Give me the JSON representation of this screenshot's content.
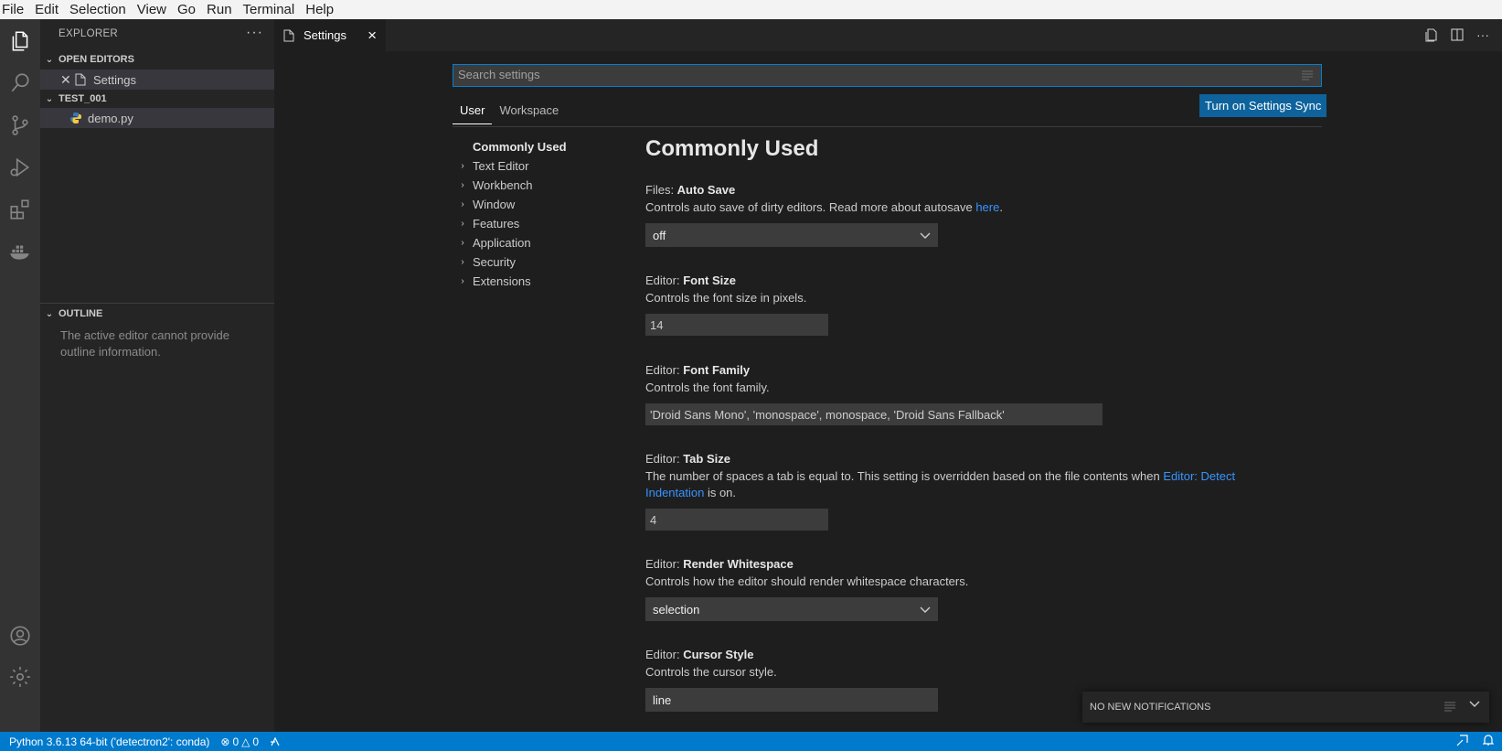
{
  "menu": [
    "File",
    "Edit",
    "Selection",
    "View",
    "Go",
    "Run",
    "Terminal",
    "Help"
  ],
  "activity_icons": [
    "files-icon",
    "search-icon",
    "source-control-icon",
    "run-debug-icon",
    "extensions-icon",
    "docker-icon",
    "account-icon",
    "settings-gear-icon"
  ],
  "explorer": {
    "title": "EXPLORER",
    "more": "···",
    "open_editors": {
      "label": "OPEN EDITORS",
      "items": [
        {
          "name": "Settings"
        }
      ]
    },
    "folder": {
      "label": "TEST_001",
      "items": [
        {
          "name": "demo.py"
        }
      ]
    },
    "outline": {
      "label": "OUTLINE",
      "message": "The active editor cannot provide outline information."
    }
  },
  "tab": {
    "label": "Settings",
    "close": "×"
  },
  "settings": {
    "search_placeholder": "Search settings",
    "scope_tabs": [
      "User",
      "Workspace"
    ],
    "sync_button": "Turn on Settings Sync",
    "toc": [
      {
        "label": "Commonly Used",
        "expandable": false
      },
      {
        "label": "Text Editor",
        "expandable": true
      },
      {
        "label": "Workbench",
        "expandable": true
      },
      {
        "label": "Window",
        "expandable": true
      },
      {
        "label": "Features",
        "expandable": true
      },
      {
        "label": "Application",
        "expandable": true
      },
      {
        "label": "Security",
        "expandable": true
      },
      {
        "label": "Extensions",
        "expandable": true
      }
    ],
    "section_title": "Commonly Used",
    "auto_save": {
      "category": "Files: ",
      "name": "Auto Save",
      "desc": "Controls auto save of dirty editors. Read more about autosave ",
      "link": "here",
      "desc_end": ".",
      "value": "off"
    },
    "font_size": {
      "category": "Editor: ",
      "name": "Font Size",
      "desc": "Controls the font size in pixels.",
      "value": "14"
    },
    "font_family": {
      "category": "Editor: ",
      "name": "Font Family",
      "desc": "Controls the font family.",
      "value": "'Droid Sans Mono', 'monospace', monospace, 'Droid Sans Fallback'"
    },
    "tab_size": {
      "category": "Editor: ",
      "name": "Tab Size",
      "desc": "The number of spaces a tab is equal to. This setting is overridden based on the file contents when ",
      "link": "Editor: Detect Indentation",
      "desc_end": " is on.",
      "value": "4"
    },
    "render_whitespace": {
      "category": "Editor: ",
      "name": "Render Whitespace",
      "desc": "Controls how the editor should render whitespace characters.",
      "value": "selection"
    },
    "cursor_style": {
      "category": "Editor: ",
      "name": "Cursor Style",
      "desc": "Controls the cursor style.",
      "value": "line"
    }
  },
  "notifications": {
    "label": "NO NEW NOTIFICATIONS"
  },
  "status": {
    "python": "Python 3.6.13 64-bit ('detectron2': conda)",
    "errors": "0",
    "warnings": "0"
  },
  "colors": {
    "accent": "#007acc",
    "button": "#0e639c",
    "link": "#3794ff"
  }
}
